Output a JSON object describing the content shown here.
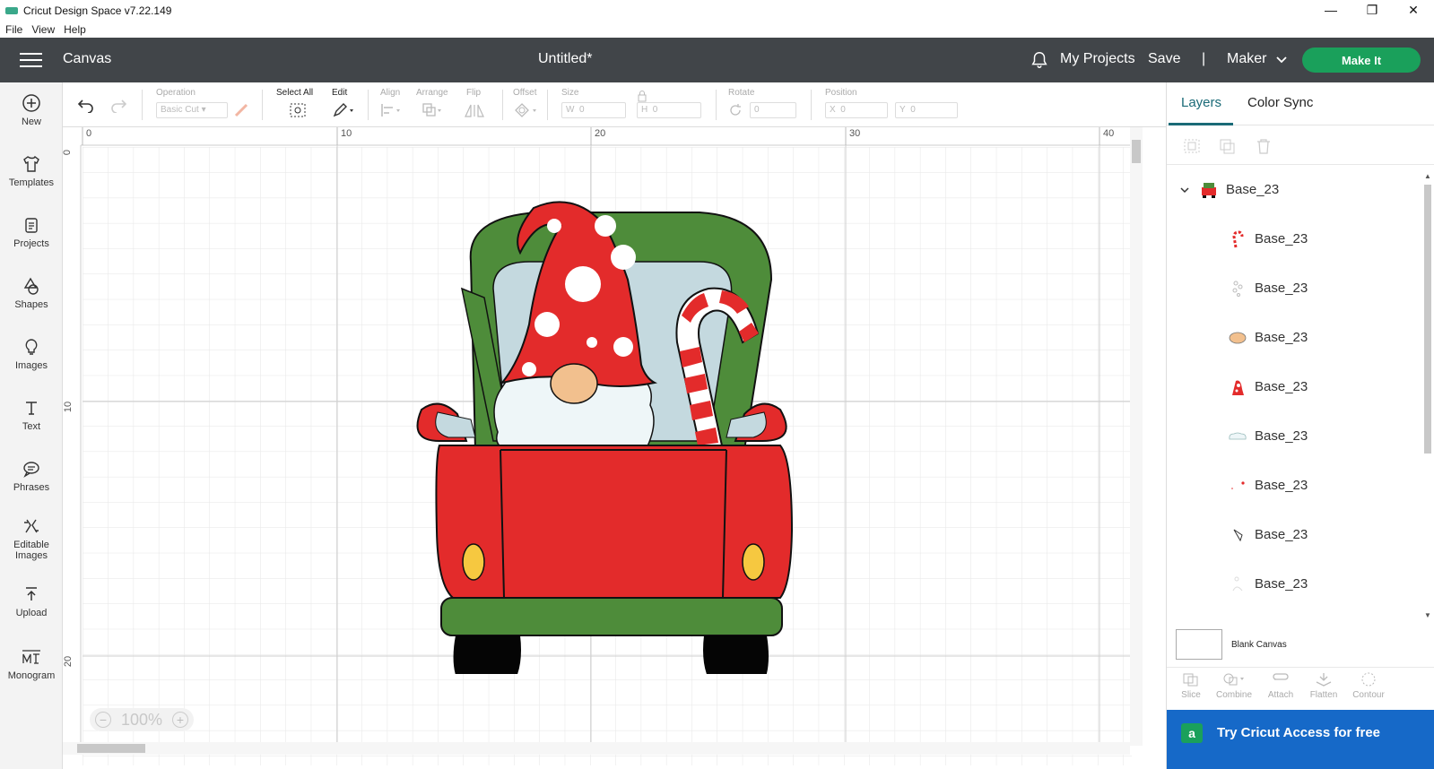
{
  "window": {
    "title": "Cricut Design Space  v7.22.149",
    "menu": [
      "File",
      "View",
      "Help"
    ]
  },
  "header": {
    "section": "Canvas",
    "doc_title": "Untitled*",
    "my_projects": "My Projects",
    "save": "Save",
    "separator": "|",
    "machine": "Maker",
    "make_it": "Make It"
  },
  "leftnav": {
    "items": [
      {
        "label": "New",
        "icon": "plus-circle-icon"
      },
      {
        "label": "Templates",
        "icon": "shirt-icon"
      },
      {
        "label": "Projects",
        "icon": "projects-icon"
      },
      {
        "label": "Shapes",
        "icon": "shapes-icon"
      },
      {
        "label": "Images",
        "icon": "bulb-icon"
      },
      {
        "label": "Text",
        "icon": "text-icon"
      },
      {
        "label": "Phrases",
        "icon": "speech-icon"
      },
      {
        "label": "Editable",
        "label2": "Images",
        "icon": "editable-images-icon"
      },
      {
        "label": "Upload",
        "icon": "upload-icon"
      },
      {
        "label": "Monogram",
        "icon": "monogram-icon"
      }
    ]
  },
  "toolbar": {
    "operation_label": "Operation",
    "operation_value": "Basic Cut",
    "select_all": "Select All",
    "edit": "Edit",
    "align": "Align",
    "arrange": "Arrange",
    "flip": "Flip",
    "offset": "Offset",
    "size": "Size",
    "w_label": "W",
    "w_value": "0",
    "h_label": "H",
    "h_value": "0",
    "rotate": "Rotate",
    "rotate_value": "0",
    "position": "Position",
    "x_label": "X",
    "x_value": "0",
    "y_label": "Y",
    "y_value": "0"
  },
  "ruler": {
    "top_ticks": [
      "0",
      "10",
      "20",
      "30",
      "40"
    ],
    "left_ticks": [
      "0",
      "10",
      "20"
    ]
  },
  "zoom": {
    "value": "100%"
  },
  "panel": {
    "tabs": [
      "Layers",
      "Color Sync"
    ],
    "group_name": "Base_23",
    "layers": [
      {
        "name": "Base_23",
        "icon": "candy-cane-thumb"
      },
      {
        "name": "Base_23",
        "icon": "dots-thumb"
      },
      {
        "name": "Base_23",
        "icon": "nose-thumb"
      },
      {
        "name": "Base_23",
        "icon": "hat-thumb"
      },
      {
        "name": "Base_23",
        "icon": "cloud-thumb"
      },
      {
        "name": "Base_23",
        "icon": "small-dots-thumb"
      },
      {
        "name": "Base_23",
        "icon": "leaf-thumb"
      },
      {
        "name": "Base_23",
        "icon": "faint-thumb"
      }
    ],
    "blank_canvas": "Blank Canvas",
    "bottom_tools": [
      "Slice",
      "Combine",
      "Attach",
      "Flatten",
      "Contour"
    ],
    "access_badge": "a",
    "access_text": "Try Cricut Access for free"
  },
  "colors": {
    "header_bg": "#414549",
    "make_it": "#1aa05b",
    "access_bg": "#1669c8",
    "truck_red": "#e32b2b",
    "truck_green": "#4e8c3a",
    "beard": "#eef6f8",
    "nose": "#f2c08e",
    "window_blue": "#c4d9df"
  }
}
